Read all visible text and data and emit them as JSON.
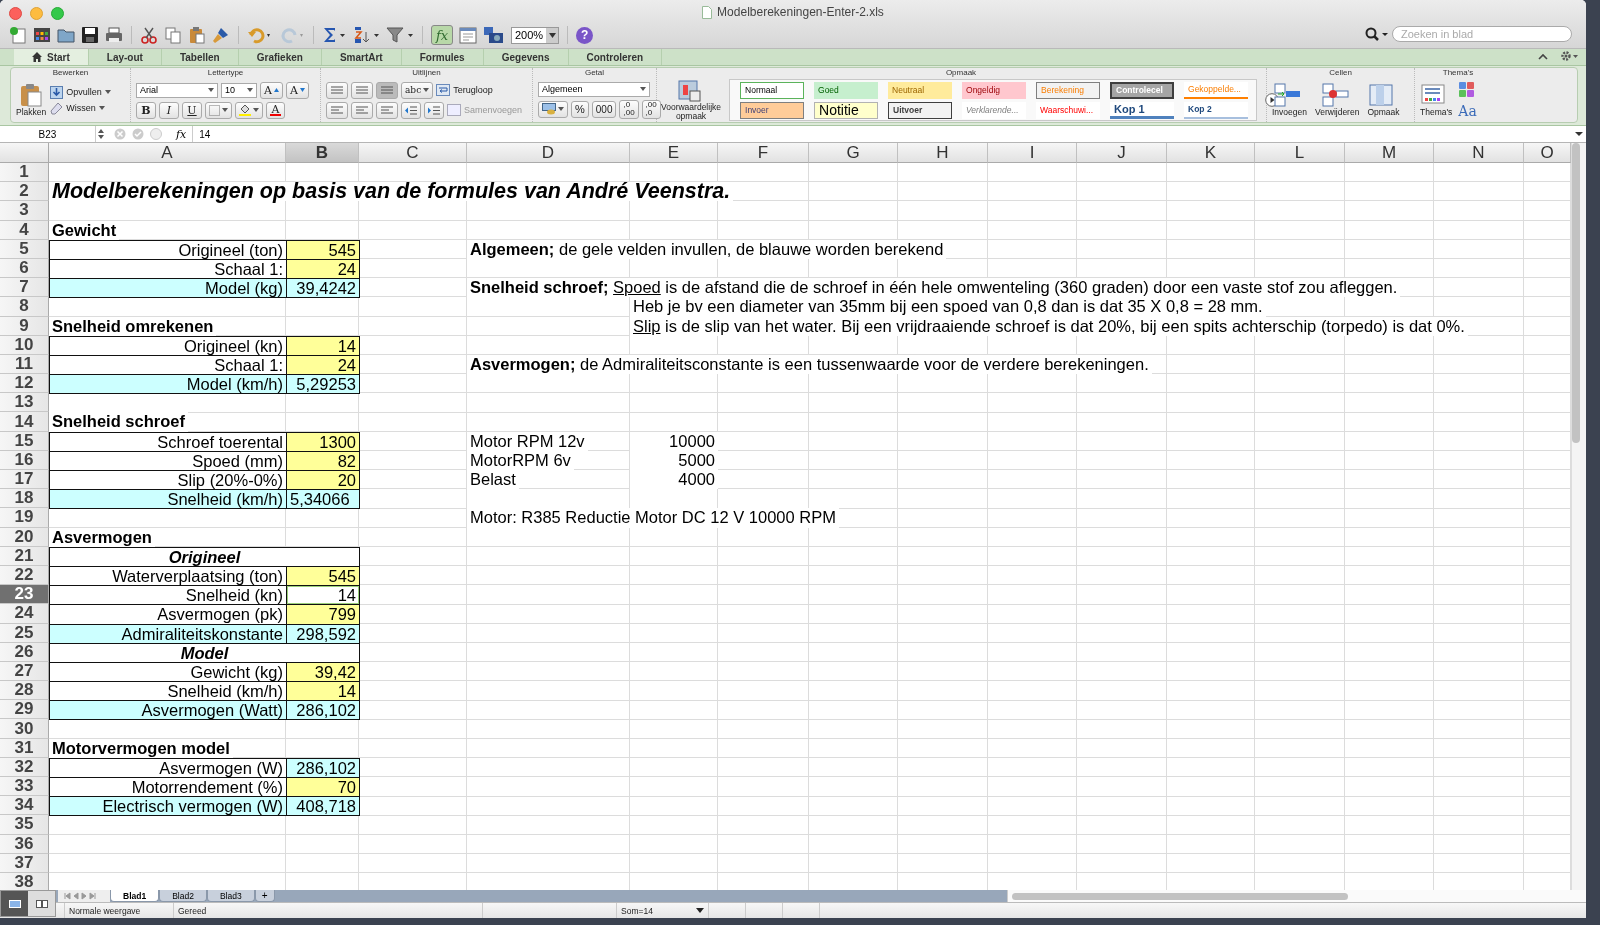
{
  "window": {
    "title": "Modelberekeningen-Enter-2.xls"
  },
  "toolbar": {
    "function_button": "fx",
    "zoom": "200%",
    "help": "?"
  },
  "search": {
    "placeholder": "Zoeken in blad"
  },
  "tabs": [
    {
      "label": "Start",
      "selected": true
    },
    {
      "label": "Lay-out",
      "selected": false
    },
    {
      "label": "Tabellen",
      "selected": false
    },
    {
      "label": "Grafieken",
      "selected": false
    },
    {
      "label": "SmartArt",
      "selected": false
    },
    {
      "label": "Formules",
      "selected": false
    },
    {
      "label": "Gegevens",
      "selected": false
    },
    {
      "label": "Controleren",
      "selected": false
    }
  ],
  "ribbon": {
    "edit": {
      "title": "Bewerken",
      "paste": "Plakken",
      "fill": "Opvullen",
      "clear": "Wissen"
    },
    "font": {
      "title": "Lettertype",
      "name": "Arial",
      "size": "10",
      "grow": "A",
      "shrink": "A",
      "bold": "B",
      "italic": "I",
      "underline": "U",
      "font_color_button": "A"
    },
    "align": {
      "title": "Uitlijnen",
      "orientation": "abc",
      "wrap": "Terugloop",
      "merge": "Samenvoegen"
    },
    "number": {
      "title": "Getal",
      "format": "Algemeen",
      "percent": "%",
      "thousands": "000",
      "increase_decimals": [
        ",0",
        ",00"
      ],
      "decrease_decimals": [
        ",00",
        ",0"
      ]
    },
    "format": {
      "title": "Opmaak",
      "conditional": "Voorwaardelijke opmaak",
      "styles": [
        {
          "label": "Normaal",
          "kind": "normaal"
        },
        {
          "label": "Goed",
          "kind": "goed"
        },
        {
          "label": "Neutraal",
          "kind": "neutraal"
        },
        {
          "label": "Ongeldig",
          "kind": "ongeldig"
        },
        {
          "label": "Berekening",
          "kind": "berekening"
        },
        {
          "label": "Controlecel",
          "kind": "controle"
        },
        {
          "label": "Gekoppelde...",
          "kind": "gekoppeld"
        },
        {
          "label": "Invoer",
          "kind": "invoer"
        },
        {
          "label": "Notitie",
          "kind": "notitie"
        },
        {
          "label": "Uitvoer",
          "kind": "uitvoer"
        },
        {
          "label": "Verklarende...",
          "kind": "verklarend"
        },
        {
          "label": "Waarschuwi...",
          "kind": "waarschuwing"
        },
        {
          "label": "Kop 1",
          "kind": "kop1"
        },
        {
          "label": "Kop 2",
          "kind": "kop2"
        }
      ]
    },
    "cells": {
      "title": "Cellen",
      "insert": "Invoegen",
      "delete": "Verwijderen",
      "format": "Opmaak"
    },
    "themes": {
      "title": "Thema's",
      "themes": "Thema's",
      "fonts": "Aa"
    }
  },
  "formula_bar": {
    "cell": "B23",
    "fx": "fx",
    "value": "14"
  },
  "sheet": {
    "columns": [
      {
        "label": "A",
        "selected": false
      },
      {
        "label": "B",
        "selected": true
      },
      {
        "label": "C",
        "selected": false
      },
      {
        "label": "D",
        "selected": false
      },
      {
        "label": "E",
        "selected": false
      },
      {
        "label": "F",
        "selected": false
      },
      {
        "label": "G",
        "selected": false
      },
      {
        "label": "H",
        "selected": false
      },
      {
        "label": "I",
        "selected": false
      },
      {
        "label": "J",
        "selected": false
      },
      {
        "label": "K",
        "selected": false
      },
      {
        "label": "L",
        "selected": false
      },
      {
        "label": "M",
        "selected": false
      },
      {
        "label": "N",
        "selected": false
      },
      {
        "label": "O",
        "selected": false
      }
    ],
    "rows": [
      {
        "number": "1",
        "selected": false
      },
      {
        "number": "2",
        "selected": false,
        "cells": [
          {
            "kind": "title",
            "text": "Modelberekeningen op basis van de formules van André Veenstra."
          }
        ]
      },
      {
        "number": "3",
        "selected": false
      },
      {
        "number": "4",
        "selected": false,
        "cells": [
          {
            "kind": "section",
            "text": "Gewicht"
          }
        ]
      },
      {
        "number": "5",
        "selected": false,
        "cells": [
          {
            "kind": "label",
            "text": "Origineel (ton)"
          },
          {
            "kind": "input",
            "text": "545"
          },
          "",
          {
            "kind": "note",
            "parts": [
              {
                "text": "Algemeen;",
                "bold": true,
                "underlined": false
              },
              {
                "text": "de gele velden invullen, de blauwe worden berekend",
                "bold": false,
                "underlined": false
              }
            ]
          }
        ]
      },
      {
        "number": "6",
        "selected": false,
        "cells": [
          {
            "kind": "label",
            "text": "Schaal 1:"
          },
          {
            "kind": "input",
            "text": "24"
          }
        ]
      },
      {
        "number": "7",
        "selected": false,
        "cells": [
          {
            "kind": "label-result",
            "text": "Model (kg)"
          },
          {
            "kind": "result",
            "text": "39,4242"
          },
          "",
          {
            "kind": "note",
            "parts": [
              {
                "text": "Snelheid schroef;",
                "bold": true,
                "underlined": false
              },
              {
                "text": "Spoed",
                "bold": false,
                "underlined": true
              },
              {
                "text": "is de afstand die de schroef in één hele omwenteling (360 graden) door een vaste stof zou afleggen.",
                "bold": false,
                "underlined": false
              }
            ]
          }
        ]
      },
      {
        "number": "8",
        "selected": false,
        "cells": [
          "",
          "",
          "",
          "",
          {
            "kind": "note",
            "parts": [
              {
                "text": "Heb je bv een diameter van 35mm bij een spoed van 0,8 dan is dat 35 X 0,8 = 28 mm.",
                "bold": false,
                "underlined": false
              }
            ]
          }
        ]
      },
      {
        "number": "9",
        "selected": false,
        "cells": [
          {
            "kind": "section",
            "text": "Snelheid omrekenen"
          },
          "",
          "",
          "",
          {
            "kind": "note",
            "parts": [
              {
                "text": "Slip",
                "bold": false,
                "underlined": true
              },
              {
                "text": "is de slip van het water. Bij een vrijdraaiende schroef is dat 20%, bij een spits achterschip (torpedo) is dat 0%.",
                "bold": false,
                "underlined": false
              }
            ]
          }
        ]
      },
      {
        "number": "10",
        "selected": false,
        "cells": [
          {
            "kind": "label",
            "text": "Origineel (kn)"
          },
          {
            "kind": "input",
            "text": "14"
          }
        ]
      },
      {
        "number": "11",
        "selected": false,
        "cells": [
          {
            "kind": "label",
            "text": "Schaal 1:"
          },
          {
            "kind": "input",
            "text": "24"
          },
          "",
          {
            "kind": "note",
            "parts": [
              {
                "text": "Asvermogen;",
                "bold": true,
                "underlined": false
              },
              {
                "text": "de Admiraliteitsconstante is een tussenwaarde voor de verdere berekeningen.",
                "bold": false,
                "underlined": false
              }
            ]
          }
        ]
      },
      {
        "number": "12",
        "selected": false,
        "cells": [
          {
            "kind": "label-result",
            "text": "Model (km/h)"
          },
          {
            "kind": "result",
            "text": "5,29253"
          }
        ]
      },
      {
        "number": "13",
        "selected": false
      },
      {
        "number": "14",
        "selected": false,
        "cells": [
          {
            "kind": "section",
            "text": "Snelheid schroef"
          }
        ]
      },
      {
        "number": "15",
        "selected": false,
        "cells": [
          {
            "kind": "label",
            "text": "Schroef toerental"
          },
          {
            "kind": "input",
            "text": "1300"
          },
          "",
          {
            "kind": "text",
            "text": "Motor RPM 12v"
          },
          {
            "kind": "number",
            "text": "10000"
          }
        ]
      },
      {
        "number": "16",
        "selected": false,
        "cells": [
          {
            "kind": "label",
            "text": "Spoed (mm)"
          },
          {
            "kind": "input",
            "text": "82"
          },
          "",
          {
            "kind": "text",
            "text": "MotorRPM 6v"
          },
          {
            "kind": "number",
            "text": "5000"
          }
        ]
      },
      {
        "number": "17",
        "selected": false,
        "cells": [
          {
            "kind": "label",
            "text": "Slip (20%-0%)"
          },
          {
            "kind": "input",
            "text": "20"
          },
          "",
          {
            "kind": "text",
            "text": "Belast"
          },
          {
            "kind": "number",
            "text": "4000"
          }
        ]
      },
      {
        "number": "18",
        "selected": false,
        "cells": [
          {
            "kind": "label-result",
            "text": "Snelheid (km/h)"
          },
          {
            "kind": "result-left",
            "text": "5,34066"
          }
        ]
      },
      {
        "number": "19",
        "selected": false,
        "cells": [
          "",
          "",
          "",
          {
            "kind": "text",
            "text": "Motor: R385 Reductie Motor DC 12 V 10000 RPM"
          }
        ]
      },
      {
        "number": "20",
        "selected": false,
        "cells": [
          {
            "kind": "section",
            "text": "Asvermogen"
          }
        ]
      },
      {
        "number": "21",
        "selected": false,
        "cells": [
          {
            "kind": "subhead",
            "text": "Origineel"
          }
        ]
      },
      {
        "number": "22",
        "selected": false,
        "cells": [
          {
            "kind": "label",
            "text": "Waterverplaatsing (ton)"
          },
          {
            "kind": "input",
            "text": "545"
          }
        ]
      },
      {
        "number": "23",
        "selected": true,
        "cells": [
          {
            "kind": "label",
            "text": "Snelheid (kn)"
          },
          {
            "kind": "value",
            "text": "14"
          }
        ]
      },
      {
        "number": "24",
        "selected": false,
        "cells": [
          {
            "kind": "label",
            "text": "Asvermogen (pk)"
          },
          {
            "kind": "input",
            "text": "799"
          }
        ]
      },
      {
        "number": "25",
        "selected": false,
        "cells": [
          {
            "kind": "label-result",
            "text": "Admiraliteitskonstante"
          },
          {
            "kind": "result",
            "text": "298,592"
          }
        ]
      },
      {
        "number": "26",
        "selected": false,
        "cells": [
          {
            "kind": "subhead",
            "text": "Model"
          }
        ]
      },
      {
        "number": "27",
        "selected": false,
        "cells": [
          {
            "kind": "label",
            "text": "Gewicht (kg)"
          },
          {
            "kind": "input",
            "text": "39,42"
          }
        ]
      },
      {
        "number": "28",
        "selected": false,
        "cells": [
          {
            "kind": "label",
            "text": "Snelheid (km/h)"
          },
          {
            "kind": "input",
            "text": "14"
          }
        ]
      },
      {
        "number": "29",
        "selected": false,
        "cells": [
          {
            "kind": "label-result",
            "text": "Asvermogen (Watt)"
          },
          {
            "kind": "result",
            "text": "286,102"
          }
        ]
      },
      {
        "number": "30",
        "selected": false
      },
      {
        "number": "31",
        "selected": false,
        "cells": [
          {
            "kind": "section",
            "text": "Motorvermogen model"
          }
        ]
      },
      {
        "number": "32",
        "selected": false,
        "cells": [
          {
            "kind": "label",
            "text": "Asvermogen (W)"
          },
          {
            "kind": "result",
            "text": "286,102"
          }
        ]
      },
      {
        "number": "33",
        "selected": false,
        "cells": [
          {
            "kind": "label",
            "text": "Motorrendement (%)"
          },
          {
            "kind": "input",
            "text": "70"
          }
        ]
      },
      {
        "number": "34",
        "selected": false,
        "cells": [
          {
            "kind": "label-result",
            "text": "Electrisch vermogen (W)"
          },
          {
            "kind": "result",
            "text": "408,718"
          }
        ]
      },
      {
        "number": "35",
        "selected": false
      },
      {
        "number": "36",
        "selected": false
      },
      {
        "number": "37",
        "selected": false
      },
      {
        "number": "38",
        "selected": false
      }
    ]
  },
  "sheet_tabs": [
    {
      "label": "Blad1",
      "selected": true
    },
    {
      "label": "Blad2",
      "selected": false
    },
    {
      "label": "Blad3",
      "selected": false
    }
  ],
  "add_sheet": "+",
  "status_bar": {
    "view": "Normale weergave",
    "state": "Gereed",
    "sum": "Som=14"
  }
}
